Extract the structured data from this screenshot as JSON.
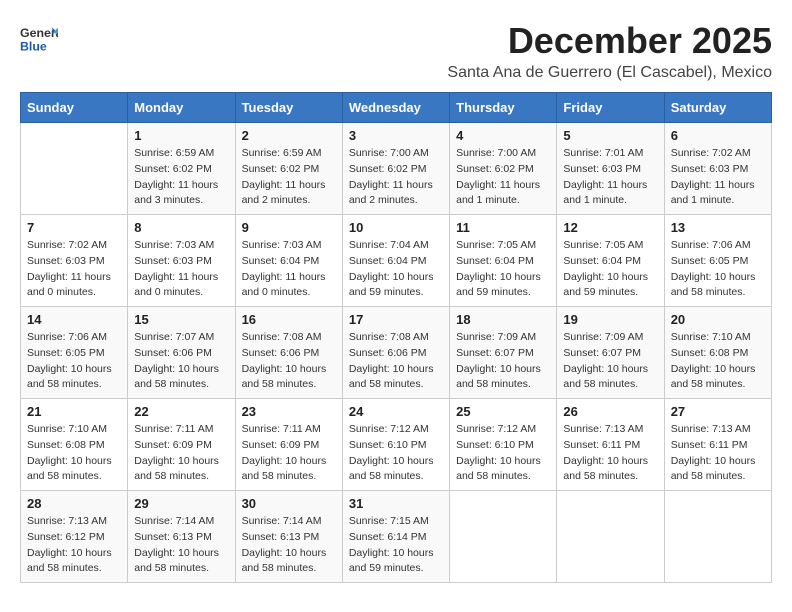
{
  "header": {
    "logo_general": "General",
    "logo_blue": "Blue",
    "month_title": "December 2025",
    "location": "Santa Ana de Guerrero (El Cascabel), Mexico"
  },
  "weekdays": [
    "Sunday",
    "Monday",
    "Tuesday",
    "Wednesday",
    "Thursday",
    "Friday",
    "Saturday"
  ],
  "weeks": [
    [
      {
        "day": "",
        "info": ""
      },
      {
        "day": "1",
        "info": "Sunrise: 6:59 AM\nSunset: 6:02 PM\nDaylight: 11 hours\nand 3 minutes."
      },
      {
        "day": "2",
        "info": "Sunrise: 6:59 AM\nSunset: 6:02 PM\nDaylight: 11 hours\nand 2 minutes."
      },
      {
        "day": "3",
        "info": "Sunrise: 7:00 AM\nSunset: 6:02 PM\nDaylight: 11 hours\nand 2 minutes."
      },
      {
        "day": "4",
        "info": "Sunrise: 7:00 AM\nSunset: 6:02 PM\nDaylight: 11 hours\nand 1 minute."
      },
      {
        "day": "5",
        "info": "Sunrise: 7:01 AM\nSunset: 6:03 PM\nDaylight: 11 hours\nand 1 minute."
      },
      {
        "day": "6",
        "info": "Sunrise: 7:02 AM\nSunset: 6:03 PM\nDaylight: 11 hours\nand 1 minute."
      }
    ],
    [
      {
        "day": "7",
        "info": "Sunrise: 7:02 AM\nSunset: 6:03 PM\nDaylight: 11 hours\nand 0 minutes."
      },
      {
        "day": "8",
        "info": "Sunrise: 7:03 AM\nSunset: 6:03 PM\nDaylight: 11 hours\nand 0 minutes."
      },
      {
        "day": "9",
        "info": "Sunrise: 7:03 AM\nSunset: 6:04 PM\nDaylight: 11 hours\nand 0 minutes."
      },
      {
        "day": "10",
        "info": "Sunrise: 7:04 AM\nSunset: 6:04 PM\nDaylight: 10 hours\nand 59 minutes."
      },
      {
        "day": "11",
        "info": "Sunrise: 7:05 AM\nSunset: 6:04 PM\nDaylight: 10 hours\nand 59 minutes."
      },
      {
        "day": "12",
        "info": "Sunrise: 7:05 AM\nSunset: 6:04 PM\nDaylight: 10 hours\nand 59 minutes."
      },
      {
        "day": "13",
        "info": "Sunrise: 7:06 AM\nSunset: 6:05 PM\nDaylight: 10 hours\nand 58 minutes."
      }
    ],
    [
      {
        "day": "14",
        "info": "Sunrise: 7:06 AM\nSunset: 6:05 PM\nDaylight: 10 hours\nand 58 minutes."
      },
      {
        "day": "15",
        "info": "Sunrise: 7:07 AM\nSunset: 6:06 PM\nDaylight: 10 hours\nand 58 minutes."
      },
      {
        "day": "16",
        "info": "Sunrise: 7:08 AM\nSunset: 6:06 PM\nDaylight: 10 hours\nand 58 minutes."
      },
      {
        "day": "17",
        "info": "Sunrise: 7:08 AM\nSunset: 6:06 PM\nDaylight: 10 hours\nand 58 minutes."
      },
      {
        "day": "18",
        "info": "Sunrise: 7:09 AM\nSunset: 6:07 PM\nDaylight: 10 hours\nand 58 minutes."
      },
      {
        "day": "19",
        "info": "Sunrise: 7:09 AM\nSunset: 6:07 PM\nDaylight: 10 hours\nand 58 minutes."
      },
      {
        "day": "20",
        "info": "Sunrise: 7:10 AM\nSunset: 6:08 PM\nDaylight: 10 hours\nand 58 minutes."
      }
    ],
    [
      {
        "day": "21",
        "info": "Sunrise: 7:10 AM\nSunset: 6:08 PM\nDaylight: 10 hours\nand 58 minutes."
      },
      {
        "day": "22",
        "info": "Sunrise: 7:11 AM\nSunset: 6:09 PM\nDaylight: 10 hours\nand 58 minutes."
      },
      {
        "day": "23",
        "info": "Sunrise: 7:11 AM\nSunset: 6:09 PM\nDaylight: 10 hours\nand 58 minutes."
      },
      {
        "day": "24",
        "info": "Sunrise: 7:12 AM\nSunset: 6:10 PM\nDaylight: 10 hours\nand 58 minutes."
      },
      {
        "day": "25",
        "info": "Sunrise: 7:12 AM\nSunset: 6:10 PM\nDaylight: 10 hours\nand 58 minutes."
      },
      {
        "day": "26",
        "info": "Sunrise: 7:13 AM\nSunset: 6:11 PM\nDaylight: 10 hours\nand 58 minutes."
      },
      {
        "day": "27",
        "info": "Sunrise: 7:13 AM\nSunset: 6:11 PM\nDaylight: 10 hours\nand 58 minutes."
      }
    ],
    [
      {
        "day": "28",
        "info": "Sunrise: 7:13 AM\nSunset: 6:12 PM\nDaylight: 10 hours\nand 58 minutes."
      },
      {
        "day": "29",
        "info": "Sunrise: 7:14 AM\nSunset: 6:13 PM\nDaylight: 10 hours\nand 58 minutes."
      },
      {
        "day": "30",
        "info": "Sunrise: 7:14 AM\nSunset: 6:13 PM\nDaylight: 10 hours\nand 58 minutes."
      },
      {
        "day": "31",
        "info": "Sunrise: 7:15 AM\nSunset: 6:14 PM\nDaylight: 10 hours\nand 59 minutes."
      },
      {
        "day": "",
        "info": ""
      },
      {
        "day": "",
        "info": ""
      },
      {
        "day": "",
        "info": ""
      }
    ]
  ]
}
